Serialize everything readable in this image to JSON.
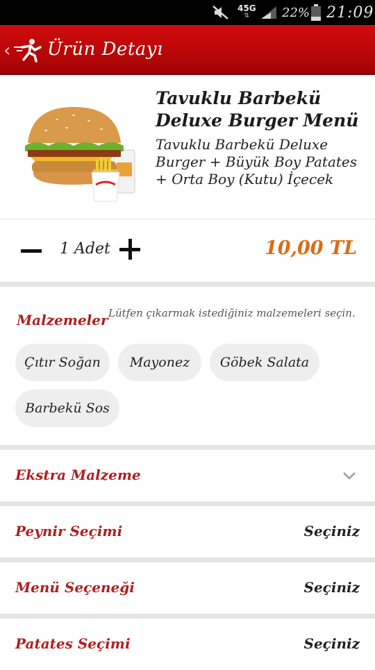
{
  "status_bar": {
    "network": "4",
    "network_suffix": "5G",
    "battery_percent": "22%",
    "time": "21:09",
    "icons": [
      "mute-icon",
      "signal-icon",
      "battery-icon"
    ]
  },
  "header": {
    "title": "Ürün Detayı",
    "back_icon": "back-chevron-icon",
    "logo_icon": "runner-logo-icon",
    "colors": {
      "bar": "#c00808"
    }
  },
  "product": {
    "name": "Tavuklu Barbekü Deluxe Burger Menü",
    "description": "Tavuklu Barbekü Deluxe Burger + Büyük Boy Patates + Orta Boy (Kutu) İçecek",
    "image_icon": "burger-menu-image"
  },
  "quantity": {
    "label": "1 Adet",
    "value": 1,
    "price": "10,00 TL",
    "price_color": "#e06a10"
  },
  "ingredients": {
    "title": "Malzemeler",
    "hint": "Lütfen çıkarmak istediğiniz malzemeleri seçin.",
    "chips": [
      "Çıtır Soğan",
      "Mayonez",
      "Göbek Salata",
      "Barbekü Sos"
    ]
  },
  "options": [
    {
      "label": "Ekstra Malzeme",
      "value": "",
      "icon": "chevron-down-icon"
    },
    {
      "label": "Peynir Seçimi",
      "value": "Seçiniz"
    },
    {
      "label": "Menü Seçeneği",
      "value": "Seçiniz"
    },
    {
      "label": "Patates Seçimi",
      "value": "Seçiniz"
    }
  ]
}
